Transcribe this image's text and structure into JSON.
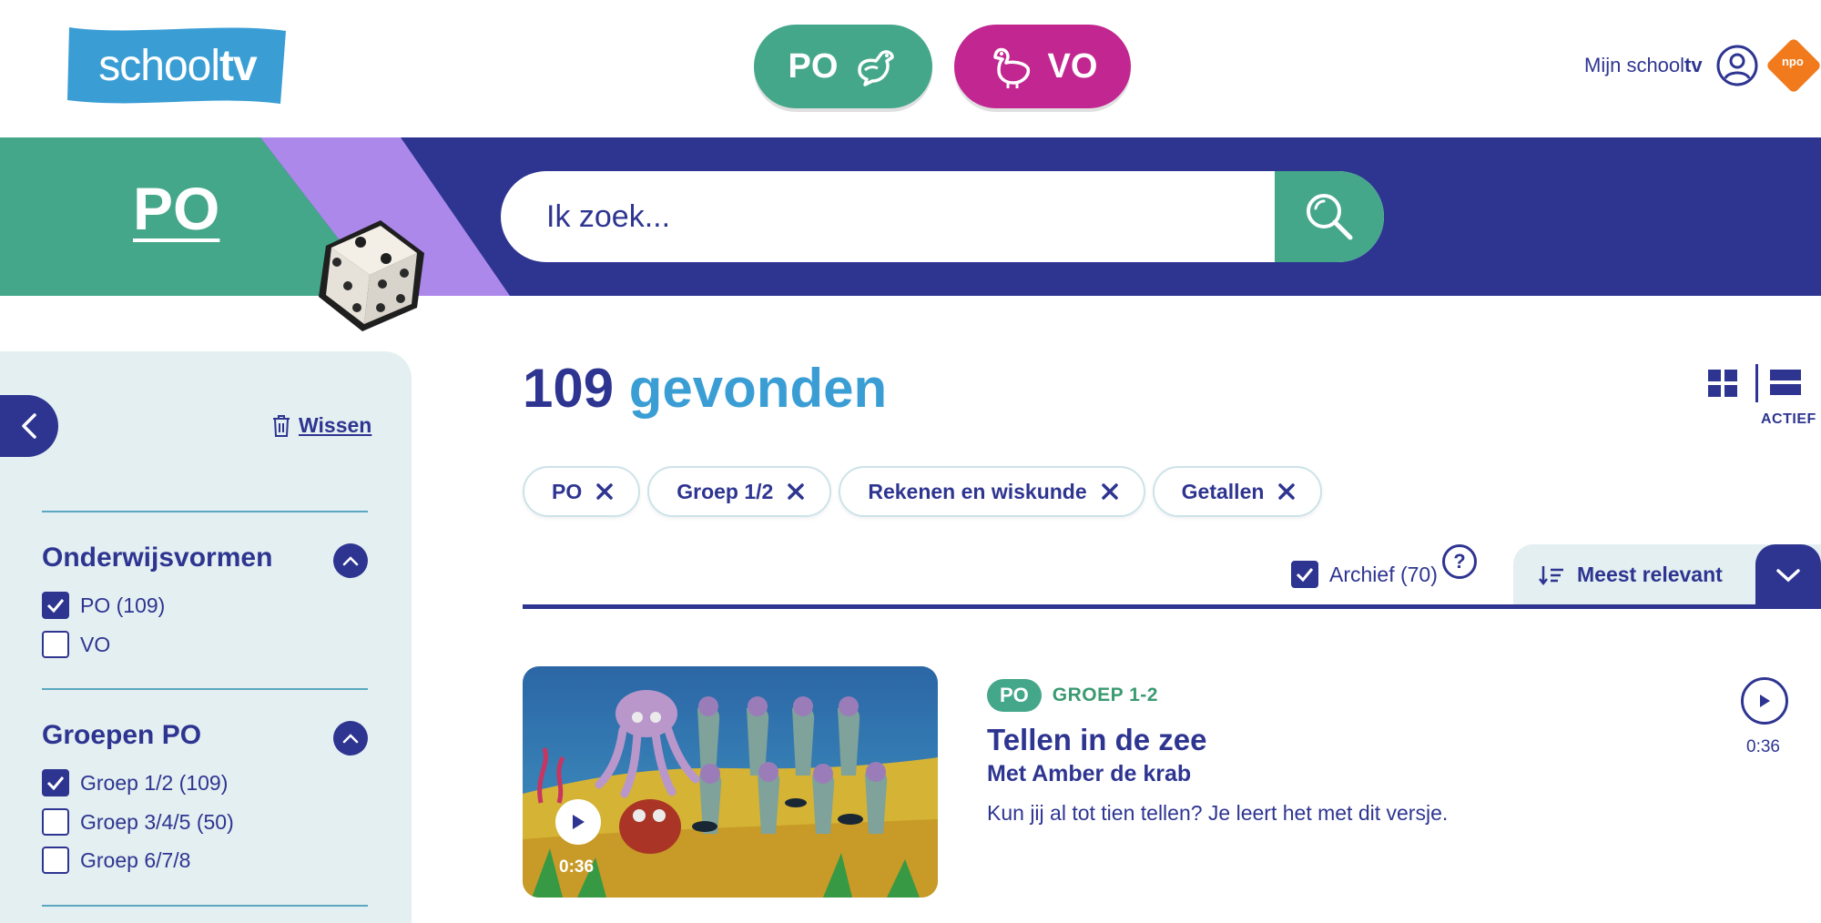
{
  "header": {
    "logo_prefix": "school",
    "logo_suffix": "tv",
    "levels": [
      {
        "label": "PO",
        "color": "#45a78a"
      },
      {
        "label": "VO",
        "color": "#c22690"
      }
    ],
    "account_prefix": "Mijn school",
    "account_suffix": "tv",
    "npo_label": "npo"
  },
  "banner": {
    "title": "PO",
    "search_placeholder": "Ik zoek..."
  },
  "sidebar": {
    "clear_label": "Wissen",
    "sections": [
      {
        "title": "Onderwijsvormen",
        "options": [
          {
            "label": "PO (109)",
            "checked": true
          },
          {
            "label": "VO",
            "checked": false
          }
        ]
      },
      {
        "title": "Groepen PO",
        "options": [
          {
            "label": "Groep 1/2 (109)",
            "checked": true
          },
          {
            "label": "Groep 3/4/5 (50)",
            "checked": false
          },
          {
            "label": "Groep 6/7/8",
            "checked": false
          }
        ]
      }
    ]
  },
  "results": {
    "count": "109",
    "count_word": "gevonden",
    "view_active_label": "ACTIEF",
    "filters": [
      "PO",
      "Groep 1/2",
      "Rekenen en wiskunde",
      "Getallen"
    ],
    "archive_label": "Archief (70)",
    "archive_checked": true,
    "help_label": "?",
    "sort_label": "Meest relevant",
    "items": [
      {
        "badge": "PO",
        "group": "GROEP 1-2",
        "title": "Tellen in de zee",
        "subtitle": "Met Amber de krab",
        "description": "Kun jij al tot tien tellen? Je leert het met dit versje.",
        "duration": "0:36"
      }
    ]
  },
  "colors": {
    "navy": "#2e3591",
    "green": "#45a78a",
    "magenta": "#c22690",
    "light_blue": "#3a9ed5",
    "sidebar_bg": "#e4eff1",
    "purple": "#ac88ea"
  }
}
